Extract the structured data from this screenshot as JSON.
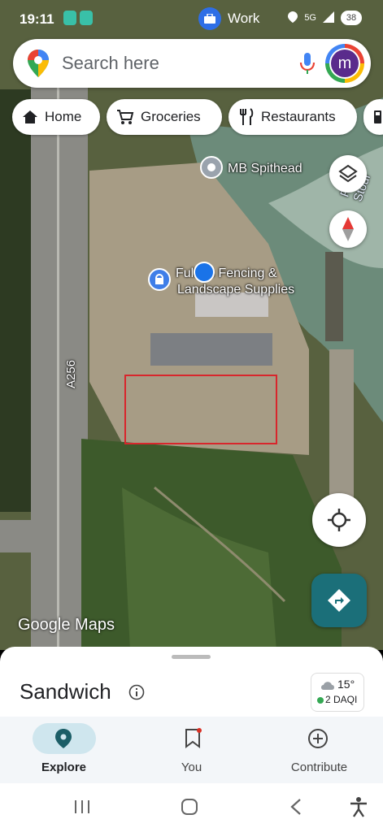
{
  "status_bar": {
    "time": "19:11",
    "work_label": "Work",
    "network": "5G",
    "battery": "38"
  },
  "search": {
    "placeholder": "Search here",
    "avatar_letter": "m"
  },
  "chips": [
    {
      "label": "Home",
      "icon": "home-icon"
    },
    {
      "label": "Groceries",
      "icon": "cart-icon"
    },
    {
      "label": "Restaurants",
      "icon": "fork-knife-icon"
    }
  ],
  "map": {
    "labels": {
      "mb_spithead": "MB Spithead",
      "fencing_line1": "Fullers Fencing &",
      "fencing_line2": "Landscape Supplies",
      "road": "A256",
      "river": "River Stour"
    },
    "watermark": "Google Maps"
  },
  "sheet": {
    "place_name": "Sandwich",
    "temperature": "15°",
    "aqi": "2 DAQI"
  },
  "bottom_nav": [
    {
      "label": "Explore",
      "icon": "explore-pin-icon",
      "active": true
    },
    {
      "label": "You",
      "icon": "bookmark-icon",
      "active": false
    },
    {
      "label": "Contribute",
      "icon": "plus-circle-icon",
      "active": false
    }
  ],
  "colors": {
    "accent": "#1b6f79",
    "active_pill": "#cfe6ee",
    "selection_box": "#d8262c"
  }
}
